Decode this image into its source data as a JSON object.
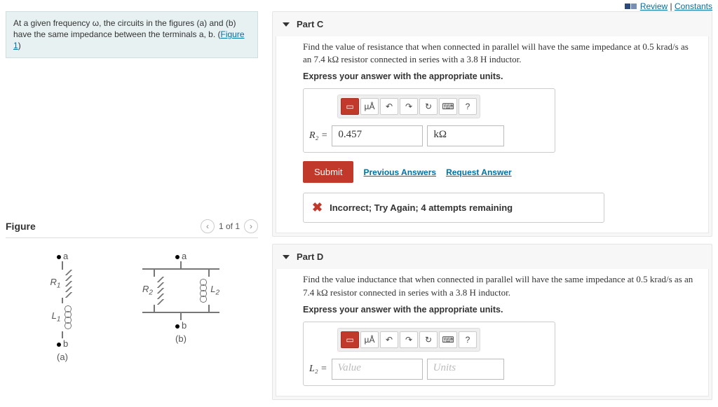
{
  "top": {
    "review": "Review",
    "constants": "Constants"
  },
  "intro": {
    "line1": "At a given frequency ω, the circuits in the figures (a) and (b) have the same impedance between the terminals a, b. (",
    "figlink": "Figure 1",
    "line2": ")"
  },
  "figure": {
    "title": "Figure",
    "pager": "1 of 1",
    "labels": {
      "a": "a",
      "b": "b",
      "R1": "R",
      "R1sub": "1",
      "L1": "L",
      "L1sub": "1",
      "R2": "R",
      "R2sub": "2",
      "L2": "L",
      "L2sub": "2",
      "capA": "(a)",
      "capB": "(b)"
    }
  },
  "partC": {
    "title": "Part C",
    "question": "Find the value of resistance that when connected in parallel will have the same impedance at 0.5 krad/s as an 7.4 kΩ resistor connected in series with a 3.8 H inductor.",
    "instr": "Express your answer with the appropriate units.",
    "toolbar": {
      "t1": "▭",
      "t2": "µÅ",
      "undo": "↶",
      "redo": "↷",
      "reset": "↻",
      "kbd": "⌨",
      "help": "?"
    },
    "var": "R₂ =",
    "value": "0.457",
    "unit": "kΩ",
    "submit": "Submit",
    "prev": "Previous Answers",
    "req": "Request Answer",
    "feedback": "Incorrect; Try Again; 4 attempts remaining"
  },
  "partD": {
    "title": "Part D",
    "question": "Find the value inductance that when connected in parallel will have the same impedance at 0.5 krad/s as an 7.4 kΩ resistor connected in series with a 3.8 H inductor.",
    "instr": "Express your answer with the appropriate units.",
    "var": "L₂ =",
    "value_ph": "Value",
    "unit_ph": "Units"
  }
}
